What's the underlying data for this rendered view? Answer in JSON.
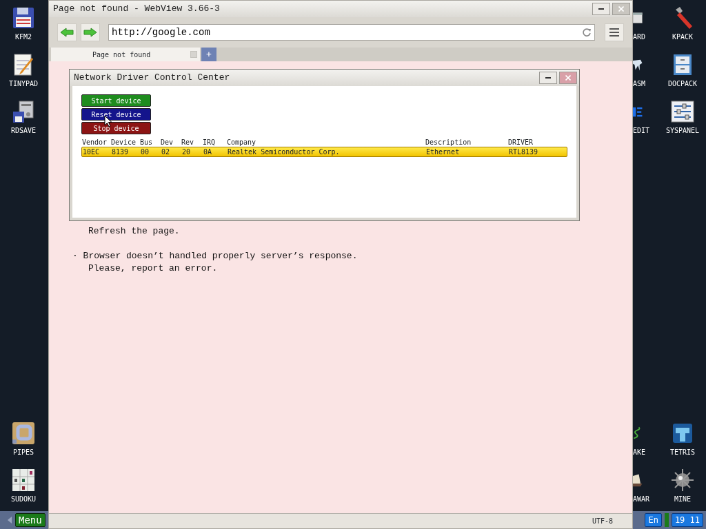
{
  "desktop": {
    "left_top_icons": [
      {
        "label": "KFM2",
        "kind": "floppy"
      },
      {
        "label": "TINYPAD",
        "kind": "notepad"
      },
      {
        "label": "RDSAVE",
        "kind": "disksave"
      }
    ],
    "left_bottom_icons": [
      {
        "label": "PIPES",
        "kind": "pipes"
      },
      {
        "label": "SUDOKU",
        "kind": "sudoku"
      }
    ],
    "partial_top_icons": [
      {
        "label": "ARD",
        "kind": "window"
      },
      {
        "label": "ASM",
        "kind": "ice"
      },
      {
        "label": "EDIT",
        "kind": "blueblock"
      }
    ],
    "partial_bottom_icons": [
      {
        "label": "AKE",
        "kind": "snake"
      },
      {
        "label": "AWAR",
        "kind": "ship"
      }
    ],
    "right_top_icons": [
      {
        "label": "KPACK",
        "kind": "wrench"
      },
      {
        "label": "DOCPACK",
        "kind": "cabinet"
      },
      {
        "label": "SYSPANEL",
        "kind": "sliders"
      }
    ],
    "right_bottom_icons": [
      {
        "label": "TETRIS",
        "kind": "tetris"
      },
      {
        "label": "MINE",
        "kind": "mine"
      }
    ]
  },
  "browser": {
    "title": "Page not found - WebView 3.66-3",
    "url": "http://google.com",
    "tabs": [
      {
        "label": "Page not found",
        "selected": true
      }
    ],
    "new_tab": "+",
    "page_lines": [
      {
        "text": "Refresh the page.",
        "kind": "continuation"
      },
      {
        "text": "· Browser doesn’t handled properly server’s response.",
        "kind": "bullet"
      },
      {
        "text": "Please, report an error.",
        "kind": "continuation"
      }
    ],
    "status_bar": "UTF-8"
  },
  "dialog": {
    "title": "Network Driver Control Center",
    "buttons": [
      {
        "label": "Start device",
        "color": "#1e8c1e"
      },
      {
        "label": "Reset device",
        "color": "#14148c"
      },
      {
        "label": "Stop device",
        "color": "#8c1414"
      }
    ],
    "columns": [
      "Vendor",
      "Device",
      "Bus",
      "Dev",
      "Rev",
      "IRQ",
      "Company",
      "Description",
      "DRIVER"
    ],
    "rows": [
      {
        "cells": [
          "10EC",
          "8139",
          "00",
          "02",
          "20",
          "0A",
          "Realtek Semiconductor Corp.",
          "Ethernet",
          "RTL8139"
        ],
        "selected": true
      }
    ]
  },
  "taskbar": {
    "menu": "Menu",
    "language": "En",
    "time": "19 11"
  }
}
